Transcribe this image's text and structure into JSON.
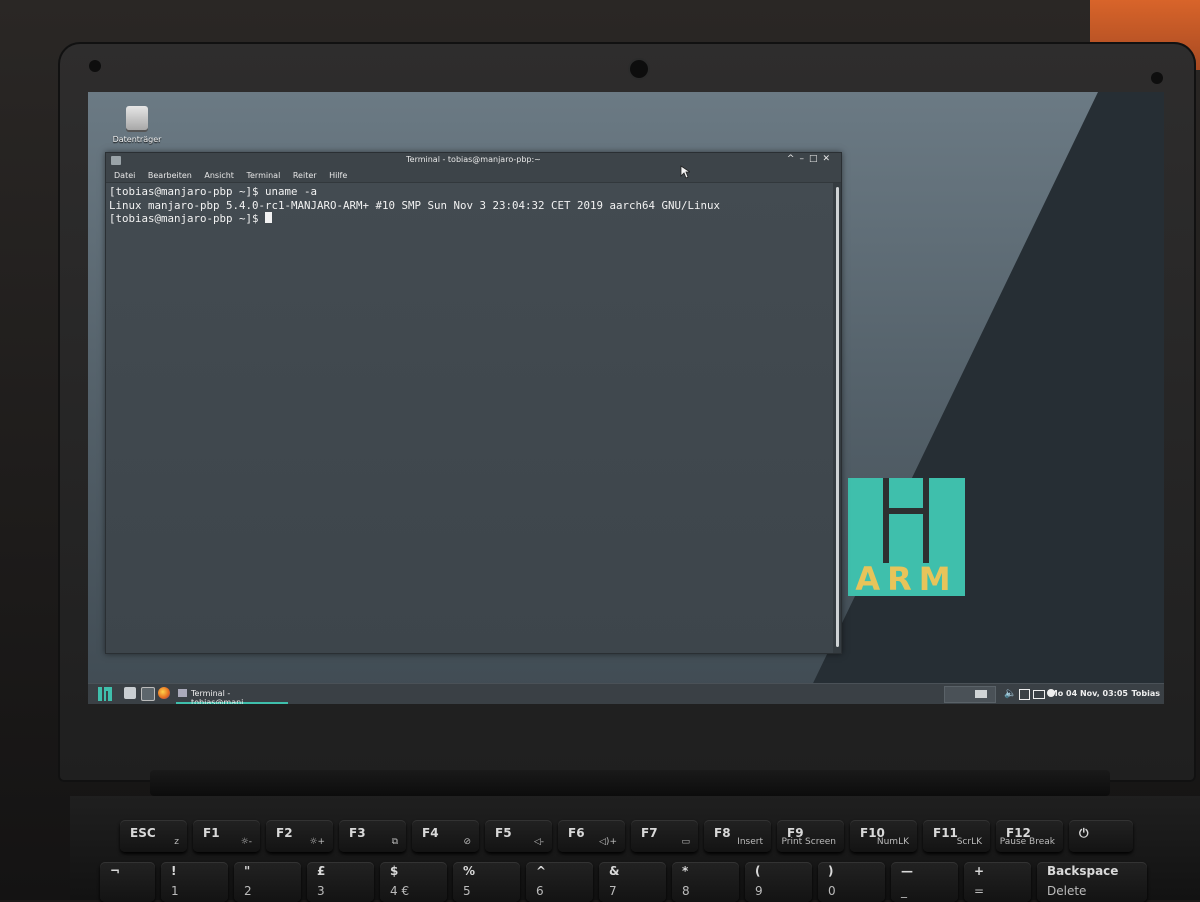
{
  "desktop": {
    "icons": [
      {
        "label": "Datenträger",
        "icon": "drive-icon"
      }
    ]
  },
  "terminal": {
    "title": "Terminal - tobias@manjaro-pbp:~",
    "window_buttons": [
      "^",
      "–",
      "□",
      "✕"
    ],
    "menu": [
      "Datei",
      "Bearbeiten",
      "Ansicht",
      "Terminal",
      "Reiter",
      "Hilfe"
    ],
    "lines": [
      "[tobias@manjaro-pbp ~]$ uname -a",
      "Linux manjaro-pbp 5.4.0-rc1-MANJARO-ARM+ #10 SMP Sun Nov 3 23:04:32 CET 2019 aarch64 GNU/Linux",
      "[tobias@manjaro-pbp ~]$ "
    ]
  },
  "wallpaper": {
    "logo_text": "ARM",
    "accent": "#3fbfac",
    "logo_text_color": "#e7c45a"
  },
  "taskbar": {
    "launchers": [
      "manjaro-menu-icon",
      "files-icon",
      "terminal-icon",
      "firefox-icon"
    ],
    "tasks": [
      {
        "label": "Terminal - tobias@manj...",
        "icon": "terminal-icon"
      }
    ],
    "clock": "Mo 04 Nov, 03:05",
    "user": "Tobias",
    "tray_icons": [
      "workspace-icon",
      "volume-icon",
      "network-icon",
      "battery-icon",
      "notification-icon"
    ]
  },
  "keyboard": {
    "top_row": [
      {
        "key": "ESC",
        "sub": "z"
      },
      {
        "key": "F1",
        "sub": "☼-"
      },
      {
        "key": "F2",
        "sub": "☼+"
      },
      {
        "key": "F3",
        "sub": "⧉"
      },
      {
        "key": "F4",
        "sub": "⊘"
      },
      {
        "key": "F5",
        "sub": "◁-"
      },
      {
        "key": "F6",
        "sub": "◁)+"
      },
      {
        "key": "F7",
        "sub": "▭"
      },
      {
        "key": "F8",
        "sub": "Insert"
      },
      {
        "key": "F9",
        "sub": "Print Screen"
      },
      {
        "key": "F10",
        "sub": "NumLK"
      },
      {
        "key": "F11",
        "sub": "ScrLK"
      },
      {
        "key": "F12",
        "sub": "Pause Break"
      },
      {
        "key": "⏻",
        "sub": ""
      }
    ],
    "number_row": [
      {
        "key": "¬",
        "sub": ""
      },
      {
        "key": "!",
        "sub": "1"
      },
      {
        "key": "\"",
        "sub": "2"
      },
      {
        "key": "£",
        "sub": "3"
      },
      {
        "key": "$",
        "sub": "4 €"
      },
      {
        "key": "%",
        "sub": "5"
      },
      {
        "key": "^",
        "sub": "6"
      },
      {
        "key": "&",
        "sub": "7"
      },
      {
        "key": "*",
        "sub": "8"
      },
      {
        "key": "(",
        "sub": "9"
      },
      {
        "key": ")",
        "sub": "0"
      },
      {
        "key": "—",
        "sub": "_"
      },
      {
        "key": "+",
        "sub": "="
      },
      {
        "key": "Backspace",
        "sub": "Delete"
      }
    ]
  }
}
